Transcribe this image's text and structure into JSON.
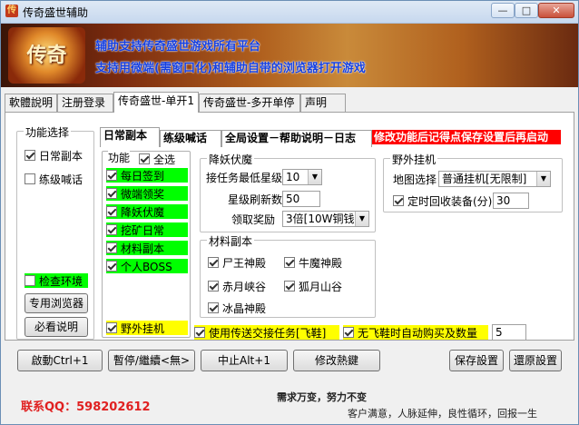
{
  "window": {
    "title": "传奇盛世辅助",
    "min_label": "—",
    "max_label": "□",
    "close_label": "✕"
  },
  "banner": {
    "logo_text": "传奇",
    "line1": "辅助支持传奇盛世游戏所有平台",
    "line2": "支持用微端(需窗口化)和辅助自带的浏览器打开游戏"
  },
  "tabs": [
    "軟體說明",
    "注册登录",
    "传奇盛世-单开1",
    "传奇盛世-多开单停",
    "声明"
  ],
  "function_select": {
    "title": "功能选择",
    "daily": "日常副本",
    "practice": "练级喊话",
    "check_env": "检查环境",
    "browser_button": "专用浏览器",
    "must_read_button": "必看说明"
  },
  "subtabs": [
    "日常副本",
    "练级喊话",
    "全局设置－帮助说明－日志"
  ],
  "restart_notice": "修改功能后记得点保存设置后再启动",
  "features": {
    "title": "功能",
    "select_all": "全选",
    "items": [
      "每日签到",
      "微端领奖",
      "降妖伏魔",
      "挖矿日常",
      "材料副本",
      "个人BOSS"
    ],
    "wild_hangup": "野外挂机"
  },
  "demon": {
    "title": "降妖伏魔",
    "min_star_label": "接任务最低星级",
    "min_star_value": "10",
    "refresh_label": "星级刷新数",
    "refresh_value": "50",
    "reward_label": "领取奖励",
    "reward_value": "3倍[10W铜钱]"
  },
  "materials": {
    "title": "材料副本",
    "items": [
      "尸王神殿",
      "牛魔神殿",
      "赤月峡谷",
      "狐月山谷",
      "冰晶神殿"
    ]
  },
  "wild": {
    "title": "野外挂机",
    "map_label": "地图选择",
    "map_value": "普通挂机[无限制]",
    "recycle_label": "定时回收装备(分)",
    "recycle_value": "30"
  },
  "bottom_options": {
    "teleport": "使用传送交接任务[飞鞋]",
    "buy_shoes": "无飞鞋时自动购买及数量",
    "buy_shoes_value": "5"
  },
  "buttons": {
    "start": "啟動Ctrl+1",
    "pause": "暫停/繼續<無>",
    "stop": "中止Alt+1",
    "hotkey": "修改熱鍵",
    "save": "保存設置",
    "restore": "還原設置"
  },
  "footer": {
    "qq": "联系QQ：598202612",
    "slogan1": "需求万变，努力不变",
    "slogan2": "客户满意，人脉延伸，良性循环，回报一生"
  },
  "colors": {
    "highlight_green": "#00ff00",
    "highlight_yellow": "#ffff00",
    "notice_red": "#ff0000",
    "banner_text": "#1640e0",
    "qq_text": "#e02020"
  }
}
